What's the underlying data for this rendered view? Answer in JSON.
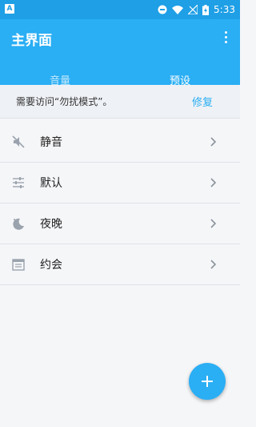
{
  "status_bar": {
    "app_badge": "A",
    "time": "5:33"
  },
  "app_bar": {
    "title": "主界面"
  },
  "tabs": [
    {
      "label": "音量",
      "active": false
    },
    {
      "label": "预设",
      "active": true
    }
  ],
  "notice": {
    "text": "需要访问“勿扰模式”。",
    "action": "修复"
  },
  "presets": [
    {
      "label": "静音",
      "icon": "mute-icon"
    },
    {
      "label": "默认",
      "icon": "sliders-icon"
    },
    {
      "label": "夜晚",
      "icon": "moon-icon"
    },
    {
      "label": "约会",
      "icon": "calendar-icon"
    }
  ],
  "colors": {
    "primary": "#2aaef4",
    "status_bar": "#1e9fe6",
    "background": "#f5f6f8"
  }
}
